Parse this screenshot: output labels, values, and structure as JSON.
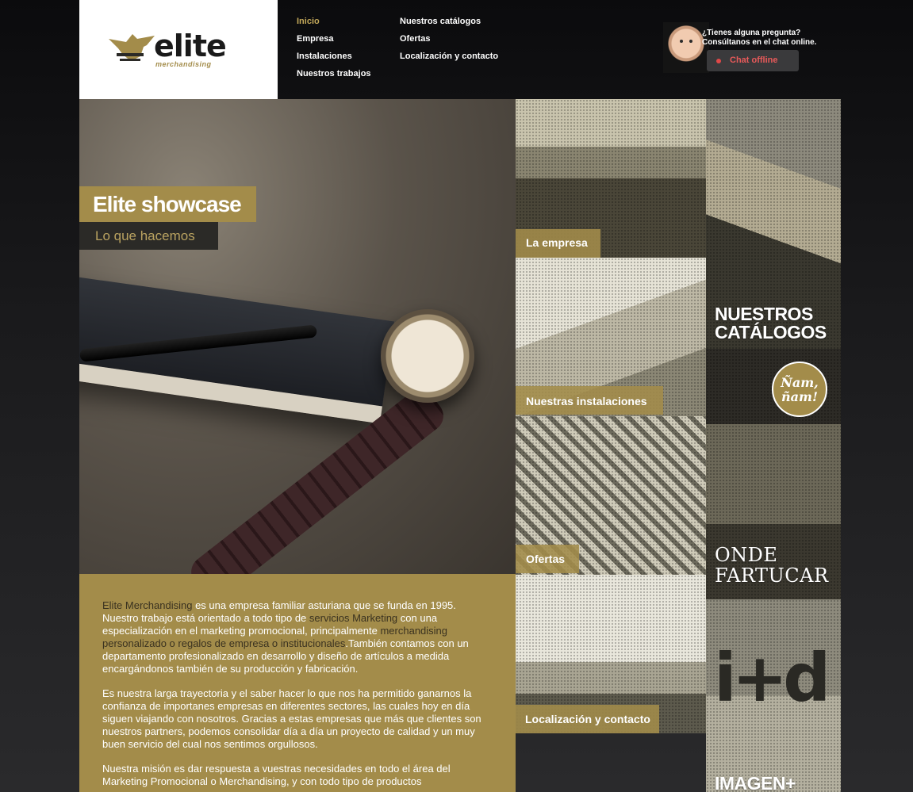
{
  "brand": {
    "name": "elite",
    "tagline": "merchandising",
    "accent_color": "#a38c4a",
    "dark_color": "#2b2a27"
  },
  "nav": {
    "col1": [
      "Inicio",
      "Empresa",
      "Instalaciones",
      "Nuestros trabajos"
    ],
    "col2": [
      "Nuestros catálogos",
      "Ofertas",
      "Localización y contacto"
    ],
    "active": "Inicio"
  },
  "chat": {
    "line1": "¿Tienes alguna pregunta?",
    "line2": "Consúltanos en el chat online.",
    "status_label": "Chat offline",
    "status_color": "#e04848"
  },
  "hero": {
    "title": "Elite showcase",
    "subtitle": "Lo que hacemos"
  },
  "intro": {
    "p1": {
      "a": "Elite Merchandising",
      "b": " es una empresa familiar asturiana que se funda en 1995. Nuestro trabajo está orientado a todo tipo de ",
      "c": "servicios Marketing",
      "d": " con una especialización en el marketing promocional, principalmente ",
      "e": "merchandising personalizado o regalos de empresa o institucionales",
      "f": ".También contamos con un departamento profesionalizado en desarrollo y diseño de artículos a medida encargándonos también de su producción y fabricación."
    },
    "p2": "Es nuestra larga trayectoria y el saber hacer lo que nos ha permitido ganarnos la confianza de importanes empresas en diferentes sectores, las cuales hoy en día siguen viajando con nosotros. Gracias a estas empresas que más que clientes son nuestros partners, podemos consolidar día a día un proyecto de calidad y un muy buen servicio del cual nos sentimos orgullosos.",
    "p3": "Nuestra misión es dar respuesta a vuestras necesidades en todo el área del Marketing Promocional o Merchandising, y con todo tipo de productos"
  },
  "tiles": {
    "empresa": "La empresa",
    "instalaciones": "Nuestras instalaciones",
    "ofertas": "Ofertas",
    "localizacion": "Localización y contacto",
    "catalogos_1": "NUESTROS",
    "catalogos_2": "CATÁLOGOS",
    "onde_bubble_1": "Ñam,",
    "onde_bubble_2": "ñam!",
    "onde_1": "ONDE",
    "onde_2": "FARTUCAR",
    "imagen": "IMAGEN+",
    "imagen_art": "i+d"
  }
}
